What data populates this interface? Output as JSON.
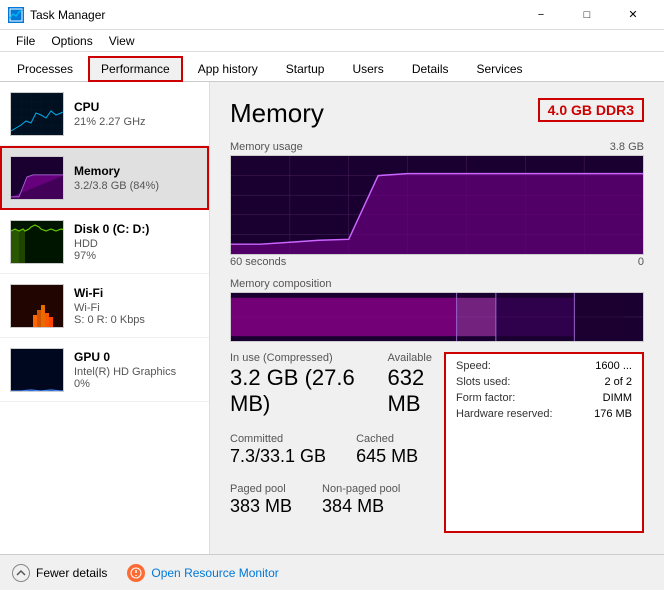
{
  "titlebar": {
    "icon": "TM",
    "title": "Task Manager",
    "controls": {
      "minimize": "−",
      "maximize": "□",
      "close": "✕"
    }
  },
  "menubar": {
    "items": [
      "File",
      "Options",
      "View"
    ]
  },
  "tabs": {
    "items": [
      "Processes",
      "Performance",
      "App history",
      "Startup",
      "Users",
      "Details",
      "Services"
    ],
    "active": "Performance"
  },
  "sidebar": {
    "items": [
      {
        "name": "CPU",
        "sub1": "21% 2.27 GHz",
        "sub2": "",
        "type": "cpu"
      },
      {
        "name": "Memory",
        "sub1": "3.2/3.8 GB (84%)",
        "sub2": "",
        "type": "memory",
        "active": true
      },
      {
        "name": "Disk 0 (C: D:)",
        "sub1": "HDD",
        "sub2": "97%",
        "type": "disk"
      },
      {
        "name": "Wi-Fi",
        "sub1": "Wi-Fi",
        "sub2": "S: 0 R: 0 Kbps",
        "type": "wifi"
      },
      {
        "name": "GPU 0",
        "sub1": "Intel(R) HD Graphics",
        "sub2": "0%",
        "type": "gpu"
      }
    ]
  },
  "panel": {
    "title": "Memory",
    "badge": "4.0 GB DDR3",
    "usage_chart_label": "Memory usage",
    "usage_chart_max": "3.8 GB",
    "time_start": "60 seconds",
    "time_end": "0",
    "composition_label": "Memory composition",
    "stats": {
      "in_use_label": "In use (Compressed)",
      "in_use_value": "3.2 GB (27.6 MB)",
      "available_label": "Available",
      "available_value": "632 MB",
      "committed_label": "Committed",
      "committed_value": "7.3/33.1 GB",
      "cached_label": "Cached",
      "cached_value": "645 MB",
      "paged_label": "Paged pool",
      "paged_value": "383 MB",
      "nonpaged_label": "Non-paged pool",
      "nonpaged_value": "384 MB"
    },
    "info": {
      "speed_label": "Speed:",
      "speed_value": "1600 ...",
      "slots_label": "Slots used:",
      "slots_value": "2 of 2",
      "form_label": "Form factor:",
      "form_value": "DIMM",
      "hw_label": "Hardware reserved:",
      "hw_value": "176 MB"
    }
  },
  "bottombar": {
    "fewer_label": "Fewer details",
    "monitor_label": "Open Resource Monitor"
  }
}
